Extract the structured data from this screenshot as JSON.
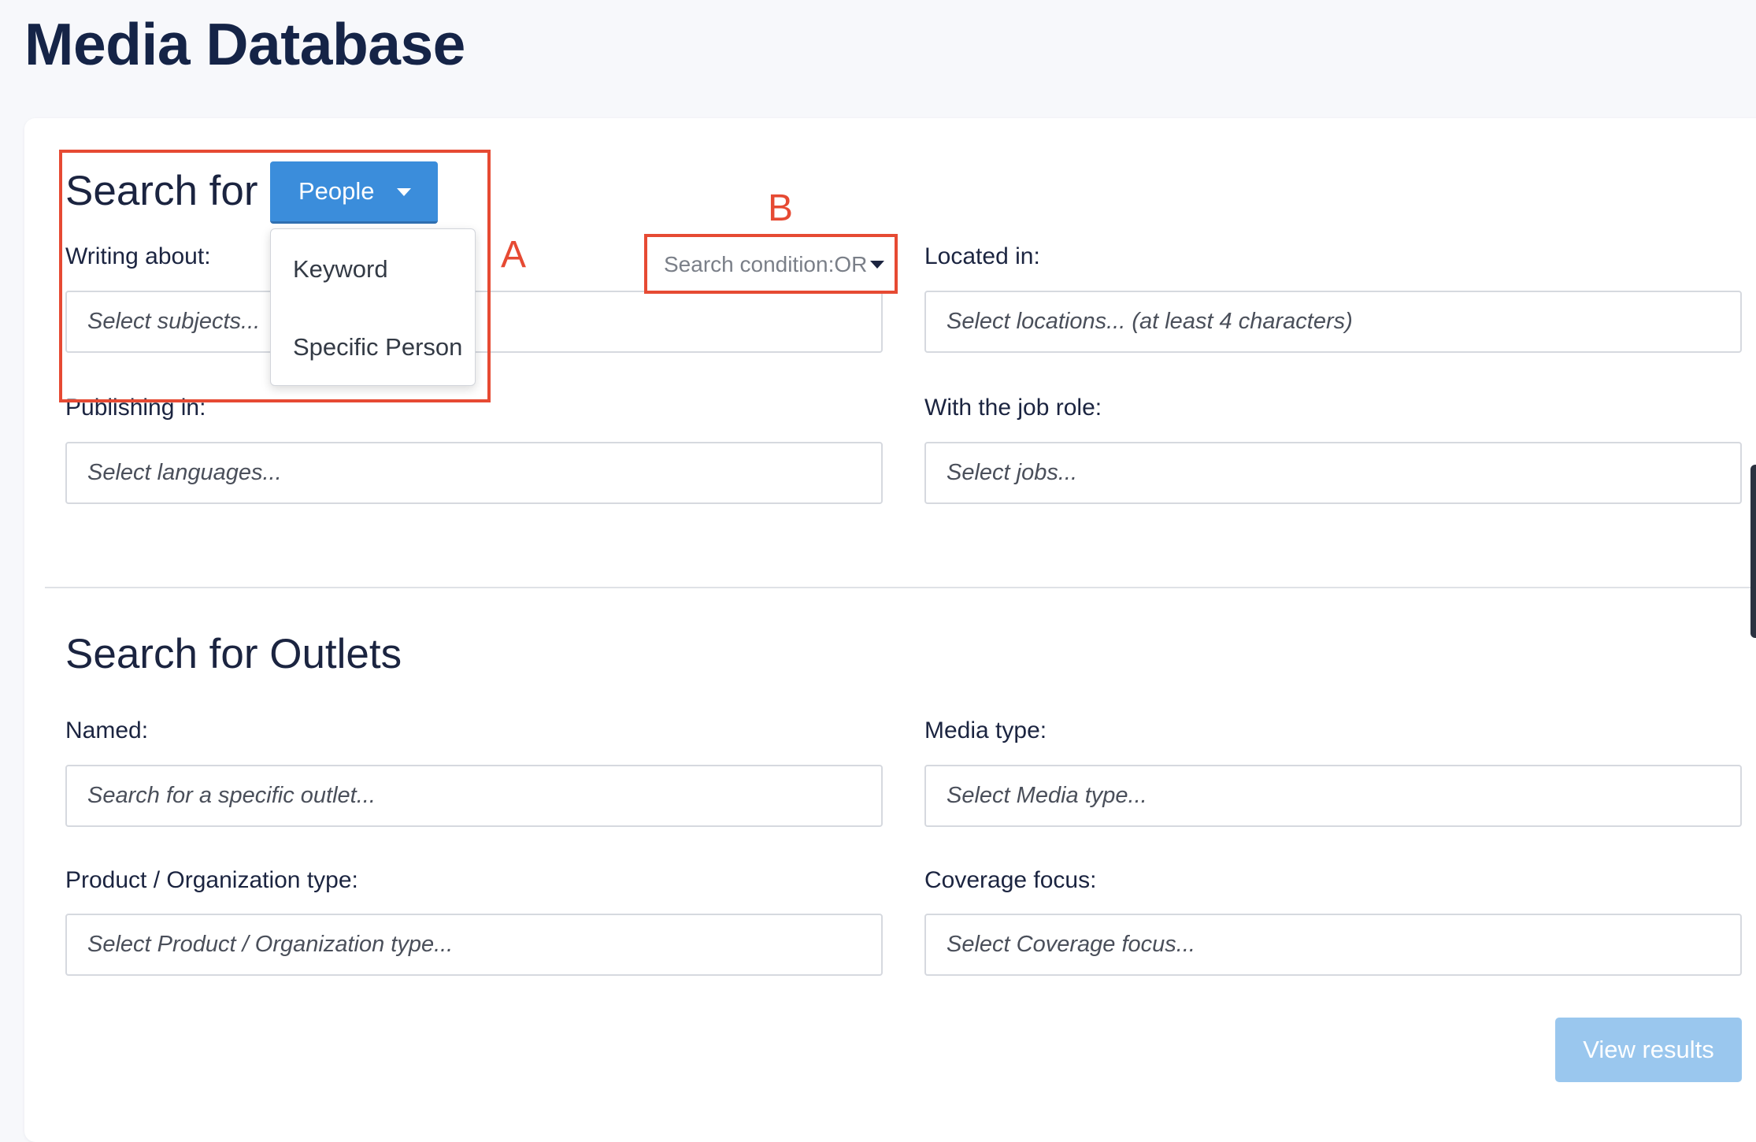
{
  "page": {
    "title": "Media Database"
  },
  "people_section": {
    "heading": "Search for",
    "type_button_label": "People",
    "dropdown_items": [
      "Keyword",
      "Specific Person"
    ],
    "search_condition": "Search condition:OR",
    "fields": {
      "writing_about": {
        "label": "Writing about:",
        "placeholder": "Select subjects..."
      },
      "located_in": {
        "label": "Located in:",
        "placeholder": "Select locations... (at least 4 characters)"
      },
      "publishing_in": {
        "label": "Publishing in:",
        "placeholder": "Select languages..."
      },
      "job_role": {
        "label": "With the job role:",
        "placeholder": "Select jobs..."
      }
    }
  },
  "outlets_section": {
    "heading": "Search for Outlets",
    "fields": {
      "named": {
        "label": "Named:",
        "placeholder": "Search for a specific outlet..."
      },
      "media_type": {
        "label": "Media type:",
        "placeholder": "Select Media type..."
      },
      "product_type": {
        "label": "Product / Organization type:",
        "placeholder": "Select Product / Organization type..."
      },
      "coverage_focus": {
        "label": "Coverage focus:",
        "placeholder": "Select Coverage focus..."
      }
    }
  },
  "view_results_label": "View results",
  "annotations": {
    "a": "A",
    "b": "B"
  },
  "colors": {
    "primary_button": "#3b8ddb",
    "view_results_disabled": "#9ac7ee",
    "annotation": "#e64a33",
    "heading_text": "#152447"
  }
}
